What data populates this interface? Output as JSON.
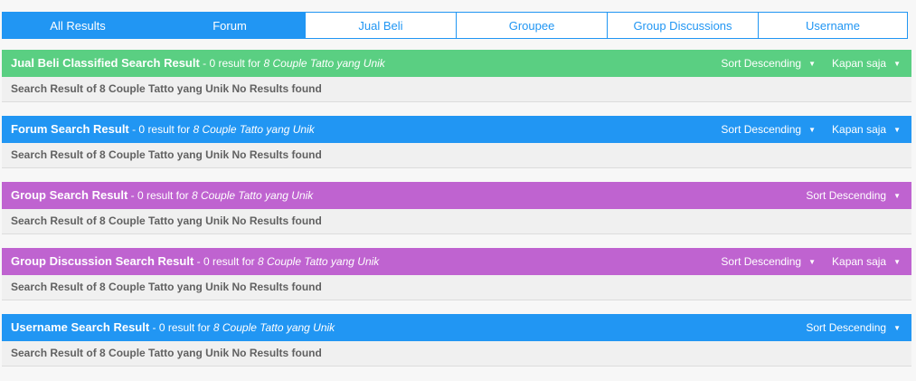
{
  "tabs": [
    "All Results",
    "Forum",
    "Jual Beli",
    "Groupee",
    "Group Discussions",
    "Username"
  ],
  "sections": [
    {
      "title": "Jual Beli Classified Search Result",
      "count_text": " - 0 result for ",
      "query": "8 Couple Tatto yang Unik",
      "sort_label": "Sort Descending",
      "time_label": "Kapan saja",
      "body": "Search Result of 8 Couple Tatto yang Unik No Results found",
      "color": "#5acf82"
    },
    {
      "title": "Forum Search Result",
      "count_text": " - 0 result for ",
      "query": "8 Couple Tatto yang Unik",
      "sort_label": "Sort Descending",
      "time_label": "Kapan saja",
      "body": "Search Result of 8 Couple Tatto yang Unik No Results found",
      "color": "#2196f3"
    },
    {
      "title": "Group Search Result",
      "count_text": " - 0 result for ",
      "query": "8 Couple Tatto yang Unik",
      "sort_label": "Sort Descending",
      "body": "Search Result of 8 Couple Tatto yang Unik No Results found",
      "color": "#bf63d0"
    },
    {
      "title": "Group Discussion Search Result",
      "count_text": " - 0 result for ",
      "query": "8 Couple Tatto yang Unik",
      "sort_label": "Sort Descending",
      "time_label": "Kapan saja",
      "body": "Search Result of 8 Couple Tatto yang Unik No Results found",
      "color": "#bf63d0"
    },
    {
      "title": "Username Search Result",
      "count_text": " - 0 result for ",
      "query": "8 Couple Tatto yang Unik",
      "sort_label": "Sort Descending",
      "body": "Search Result of 8 Couple Tatto yang Unik No Results found",
      "color": "#2196f3"
    }
  ],
  "icons": {
    "dropdown": "caret-down-icon"
  },
  "colors": {
    "active_tab": "#2196f3",
    "inactive_tab_text": "#2196f3"
  }
}
